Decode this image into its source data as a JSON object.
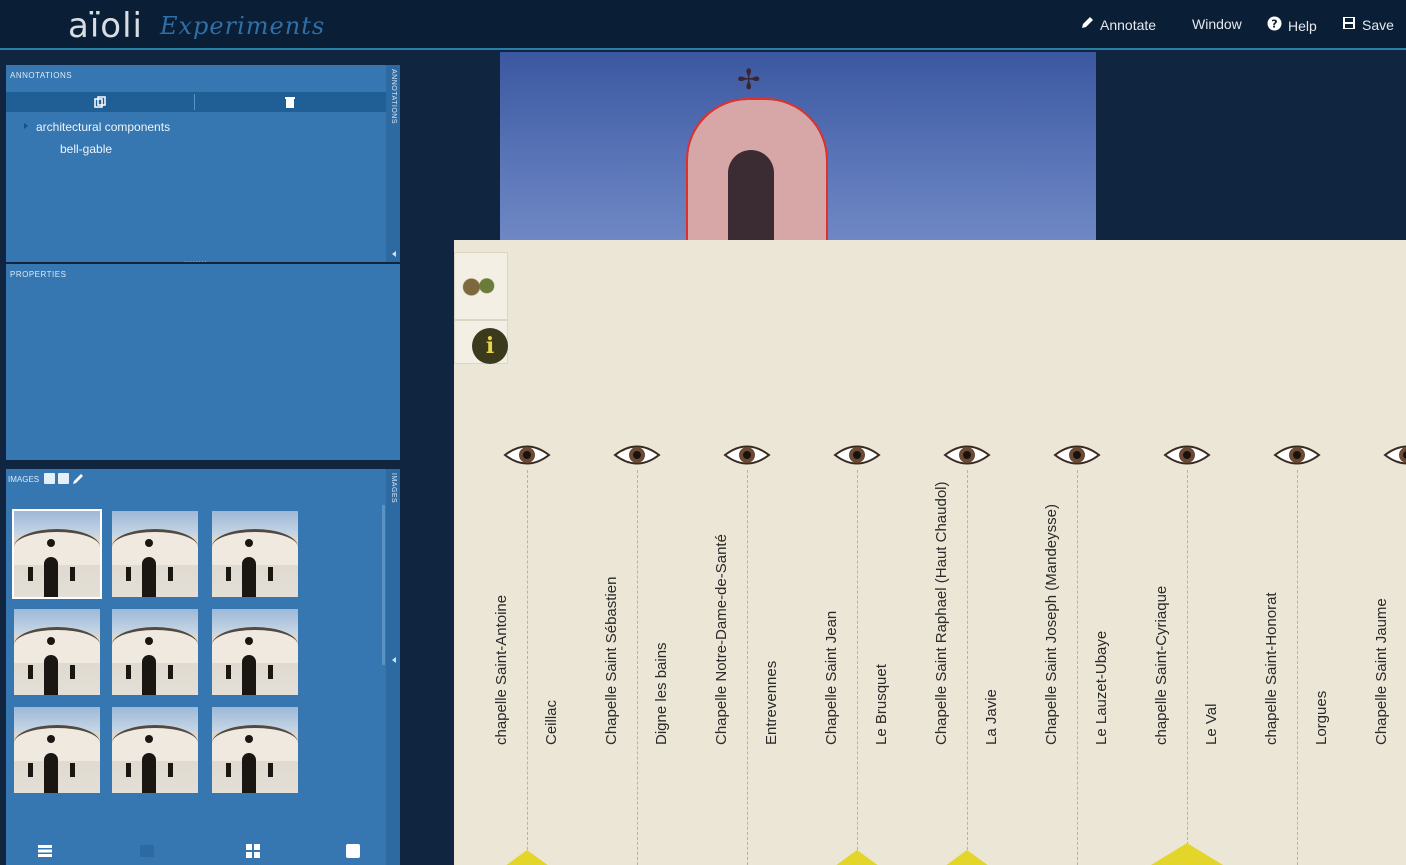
{
  "app": {
    "logo": "aïoli",
    "subtitle": "Experiments"
  },
  "menu": {
    "annotate": "Annotate",
    "window": "Window",
    "help": "Help",
    "save": "Save"
  },
  "annotations_panel": {
    "title": "Annotations",
    "side_label": "Annotations",
    "tree": {
      "root": "architectural components",
      "child": "bell-gable"
    }
  },
  "properties_panel": {
    "title": "Properties"
  },
  "images_panel": {
    "title": "Images",
    "side_label": "Images"
  },
  "timeline": {
    "entries": [
      {
        "title": "chapelle Saint-Antoine",
        "place": "Ceillac"
      },
      {
        "title": "Chapelle Saint Sébastien",
        "place": "Digne les bains"
      },
      {
        "title": "Chapelle Notre-Dame-de-Santé",
        "place": "Entrevennes"
      },
      {
        "title": "Chapelle Saint Jean",
        "place": "Le Brusquet"
      },
      {
        "title": "Chapelle Saint Raphael (Haut Chaudol)",
        "place": "La Javie"
      },
      {
        "title": "Chapelle Saint Joseph (Mandeysse)",
        "place": "Le Lauzet-Ubaye"
      },
      {
        "title": "chapelle Saint-Cyriaque",
        "place": "Le Val"
      },
      {
        "title": "chapelle Saint-Honorat",
        "place": "Lorgues"
      },
      {
        "title": "Chapelle Saint Jaume",
        "place": ""
      }
    ]
  },
  "colors": {
    "topbar": "#0a1e35",
    "panel": "#3677b2",
    "accent": "#2a7fa8",
    "timeline_bg": "#ece6d6",
    "marker": "#e3d52a",
    "annotation_outline": "#e0302a"
  }
}
